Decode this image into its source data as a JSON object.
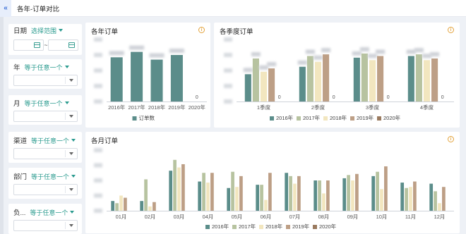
{
  "header": {
    "collapse_icon": "«",
    "title": "各年-订单对比"
  },
  "filters": {
    "date": {
      "label": "日期",
      "selector": "选择范围",
      "range_sep": "~",
      "start": "",
      "end": ""
    },
    "year": {
      "label": "年",
      "selector": "等于任意一个",
      "value": ""
    },
    "month": {
      "label": "月",
      "selector": "等于任意一个",
      "value": ""
    },
    "channel": {
      "label": "渠道",
      "selector": "等于任意一个",
      "value": ""
    },
    "department": {
      "label": "部门",
      "selector": "等于任意一个",
      "value": ""
    },
    "owner": {
      "label": "负...",
      "selector": "等于任意一个",
      "value": ""
    }
  },
  "colors": {
    "2016年": "#5b8d8a",
    "2017年": "#b7c3a0",
    "2018年": "#f2e6bf",
    "2019年": "#bd9f86",
    "2020年": "#9a7a5f",
    "订单数": "#5b8d8a"
  },
  "chart_data": [
    {
      "id": "yearly",
      "type": "bar",
      "title": "各年订单",
      "categories": [
        "2016年",
        "2017年",
        "2018年",
        "2019年",
        "2020年"
      ],
      "series": [
        {
          "name": "订单数",
          "values": [
            57,
            64,
            54,
            60,
            0
          ]
        }
      ],
      "data_labels": [
        "",
        "",
        "",
        "",
        "0"
      ],
      "ylim": [
        0,
        80
      ],
      "legend": "bottom"
    },
    {
      "id": "quarterly",
      "type": "bar",
      "title": "各季度订单",
      "categories": [
        "1季度",
        "2季度",
        "3季度",
        "4季度"
      ],
      "series": [
        {
          "name": "2016年",
          "values": [
            33,
            42,
            53,
            55
          ]
        },
        {
          "name": "2017年",
          "values": [
            52,
            55,
            58,
            57
          ]
        },
        {
          "name": "2018年",
          "values": [
            36,
            48,
            50,
            50
          ]
        },
        {
          "name": "2019年",
          "values": [
            40,
            57,
            55,
            52
          ]
        },
        {
          "name": "2020年",
          "values": [
            0,
            0,
            0,
            0
          ]
        }
      ],
      "data_labels": [
        "0",
        "0",
        "0",
        "0"
      ],
      "ylim": [
        0,
        75
      ],
      "legend": "bottom"
    },
    {
      "id": "monthly",
      "type": "bar",
      "title": "各月订单",
      "categories": [
        "01月",
        "02月",
        "03月",
        "04月",
        "05月",
        "06月",
        "07月",
        "08月",
        "09月",
        "10月",
        "11月",
        "12月"
      ],
      "series": [
        {
          "name": "2016年",
          "values": [
            4.5,
            4.5,
            18.5,
            13.5,
            10.5,
            12,
            17.5,
            14,
            15,
            16,
            13,
            12.5
          ]
        },
        {
          "name": "2017年",
          "values": [
            3.5,
            14.5,
            23.5,
            17.5,
            18,
            12,
            16,
            14,
            16.5,
            18,
            10.5,
            9
          ]
        },
        {
          "name": "2018年",
          "values": [
            7,
            2,
            20,
            13,
            11,
            5,
            12.5,
            8,
            14,
            10,
            11,
            3.5
          ]
        },
        {
          "name": "2019年",
          "values": [
            6,
            4,
            21.5,
            17.5,
            16,
            17.5,
            16,
            14,
            17,
            20.5,
            13.5,
            11
          ]
        },
        {
          "name": "2020年",
          "values": [
            0,
            0,
            0,
            0,
            0,
            0,
            0,
            0,
            0,
            0,
            0,
            0
          ]
        }
      ],
      "ylim": [
        0,
        28
      ],
      "legend": "bottom"
    }
  ]
}
